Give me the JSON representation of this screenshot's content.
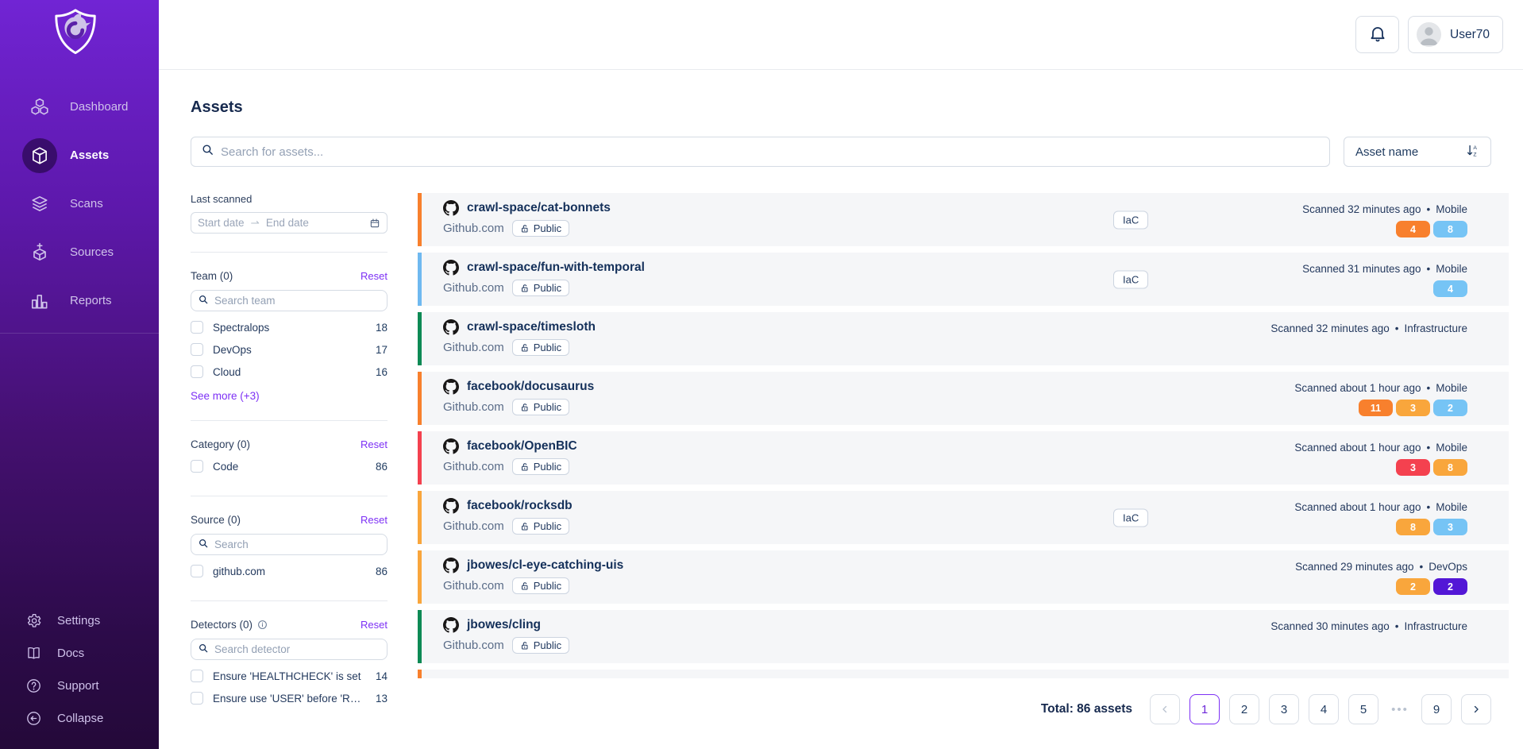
{
  "sidebar": {
    "nav": [
      {
        "label": "Dashboard",
        "icon": "dashboard-icon",
        "active": false
      },
      {
        "label": "Assets",
        "icon": "assets-icon",
        "active": true
      },
      {
        "label": "Scans",
        "icon": "scans-icon",
        "active": false
      },
      {
        "label": "Sources",
        "icon": "sources-icon",
        "active": false
      },
      {
        "label": "Reports",
        "icon": "reports-icon",
        "active": false
      }
    ],
    "footer": [
      {
        "label": "Settings",
        "icon": "gear-icon"
      },
      {
        "label": "Docs",
        "icon": "book-icon"
      },
      {
        "label": "Support",
        "icon": "question-icon"
      },
      {
        "label": "Collapse",
        "icon": "collapse-icon"
      }
    ]
  },
  "header": {
    "user": "User70"
  },
  "page": {
    "title": "Assets"
  },
  "search": {
    "placeholder": "Search for assets..."
  },
  "sort": {
    "label": "Asset name"
  },
  "filters": {
    "last_scanned": {
      "label": "Last scanned",
      "start_placeholder": "Start date",
      "end_placeholder": "End date",
      "arrow": "⇀"
    },
    "team": {
      "label": "Team (0)",
      "reset": "Reset",
      "search_placeholder": "Search team",
      "options": [
        {
          "label": "Spectralops",
          "count": "18"
        },
        {
          "label": "DevOps",
          "count": "17"
        },
        {
          "label": "Cloud",
          "count": "16"
        }
      ],
      "see_more": "See more (+3)"
    },
    "category": {
      "label": "Category (0)",
      "reset": "Reset",
      "options": [
        {
          "label": "Code",
          "count": "86"
        }
      ]
    },
    "source": {
      "label": "Source (0)",
      "reset": "Reset",
      "search_placeholder": "Search",
      "options": [
        {
          "label": "github.com",
          "count": "86"
        }
      ]
    },
    "detectors": {
      "label": "Detectors (0)",
      "reset": "Reset",
      "search_placeholder": "Search detector",
      "options": [
        {
          "label": "Ensure 'HEALTHCHECK' is set",
          "count": "14"
        },
        {
          "label": "Ensure use 'USER' before 'RUN'...",
          "count": "13"
        }
      ]
    }
  },
  "badges": {
    "iac": "IaC"
  },
  "meta": {
    "bullet": "•"
  },
  "assets": [
    {
      "name": "crawl-space/cat-bonnets",
      "source": "Github.com",
      "visibility": "Public",
      "stripe": "#F8802D",
      "iac": true,
      "scanned": "Scanned 32 minutes ago",
      "team": "Mobile",
      "chips": [
        {
          "value": "4",
          "color": "#F8802D"
        },
        {
          "value": "8",
          "color": "#76C4F5"
        }
      ]
    },
    {
      "name": "crawl-space/fun-with-temporal",
      "source": "Github.com",
      "visibility": "Public",
      "stripe": "#6FB9F0",
      "iac": true,
      "scanned": "Scanned 31 minutes ago",
      "team": "Mobile",
      "chips": [
        {
          "value": "4",
          "color": "#76C4F5"
        }
      ]
    },
    {
      "name": "crawl-space/timesloth",
      "source": "Github.com",
      "visibility": "Public",
      "stripe": "#0E8A55",
      "iac": false,
      "scanned": "Scanned 32 minutes ago",
      "team": "Infrastructure",
      "chips": []
    },
    {
      "name": "facebook/docusaurus",
      "source": "Github.com",
      "visibility": "Public",
      "stripe": "#F8802D",
      "iac": false,
      "scanned": "Scanned about 1 hour ago",
      "team": "Mobile",
      "chips": [
        {
          "value": "11",
          "color": "#F8802D"
        },
        {
          "value": "3",
          "color": "#F9A63C"
        },
        {
          "value": "2",
          "color": "#76C4F5"
        }
      ]
    },
    {
      "name": "facebook/OpenBIC",
      "source": "Github.com",
      "visibility": "Public",
      "stripe": "#F4414F",
      "iac": false,
      "scanned": "Scanned about 1 hour ago",
      "team": "Mobile",
      "chips": [
        {
          "value": "3",
          "color": "#F4414F"
        },
        {
          "value": "8",
          "color": "#F9A63C"
        }
      ]
    },
    {
      "name": "facebook/rocksdb",
      "source": "Github.com",
      "visibility": "Public",
      "stripe": "#F9A63C",
      "iac": true,
      "scanned": "Scanned about 1 hour ago",
      "team": "Mobile",
      "chips": [
        {
          "value": "8",
          "color": "#F9A63C"
        },
        {
          "value": "3",
          "color": "#76C4F5"
        }
      ]
    },
    {
      "name": "jbowes/cl-eye-catching-uis",
      "source": "Github.com",
      "visibility": "Public",
      "stripe": "#F9A63C",
      "iac": false,
      "scanned": "Scanned 29 minutes ago",
      "team": "DevOps",
      "chips": [
        {
          "value": "2",
          "color": "#F9A63C"
        },
        {
          "value": "2",
          "color": "#5317D6"
        }
      ]
    },
    {
      "name": "jbowes/cling",
      "source": "Github.com",
      "visibility": "Public",
      "stripe": "#0E8A55",
      "iac": false,
      "scanned": "Scanned 30 minutes ago",
      "team": "Infrastructure",
      "chips": []
    }
  ],
  "partial_row": {
    "stripe": "#F8802D"
  },
  "pagination": {
    "total": "Total: 86 assets",
    "pages": [
      "1",
      "2",
      "3",
      "4",
      "5",
      "...",
      "9"
    ],
    "active": "1"
  }
}
